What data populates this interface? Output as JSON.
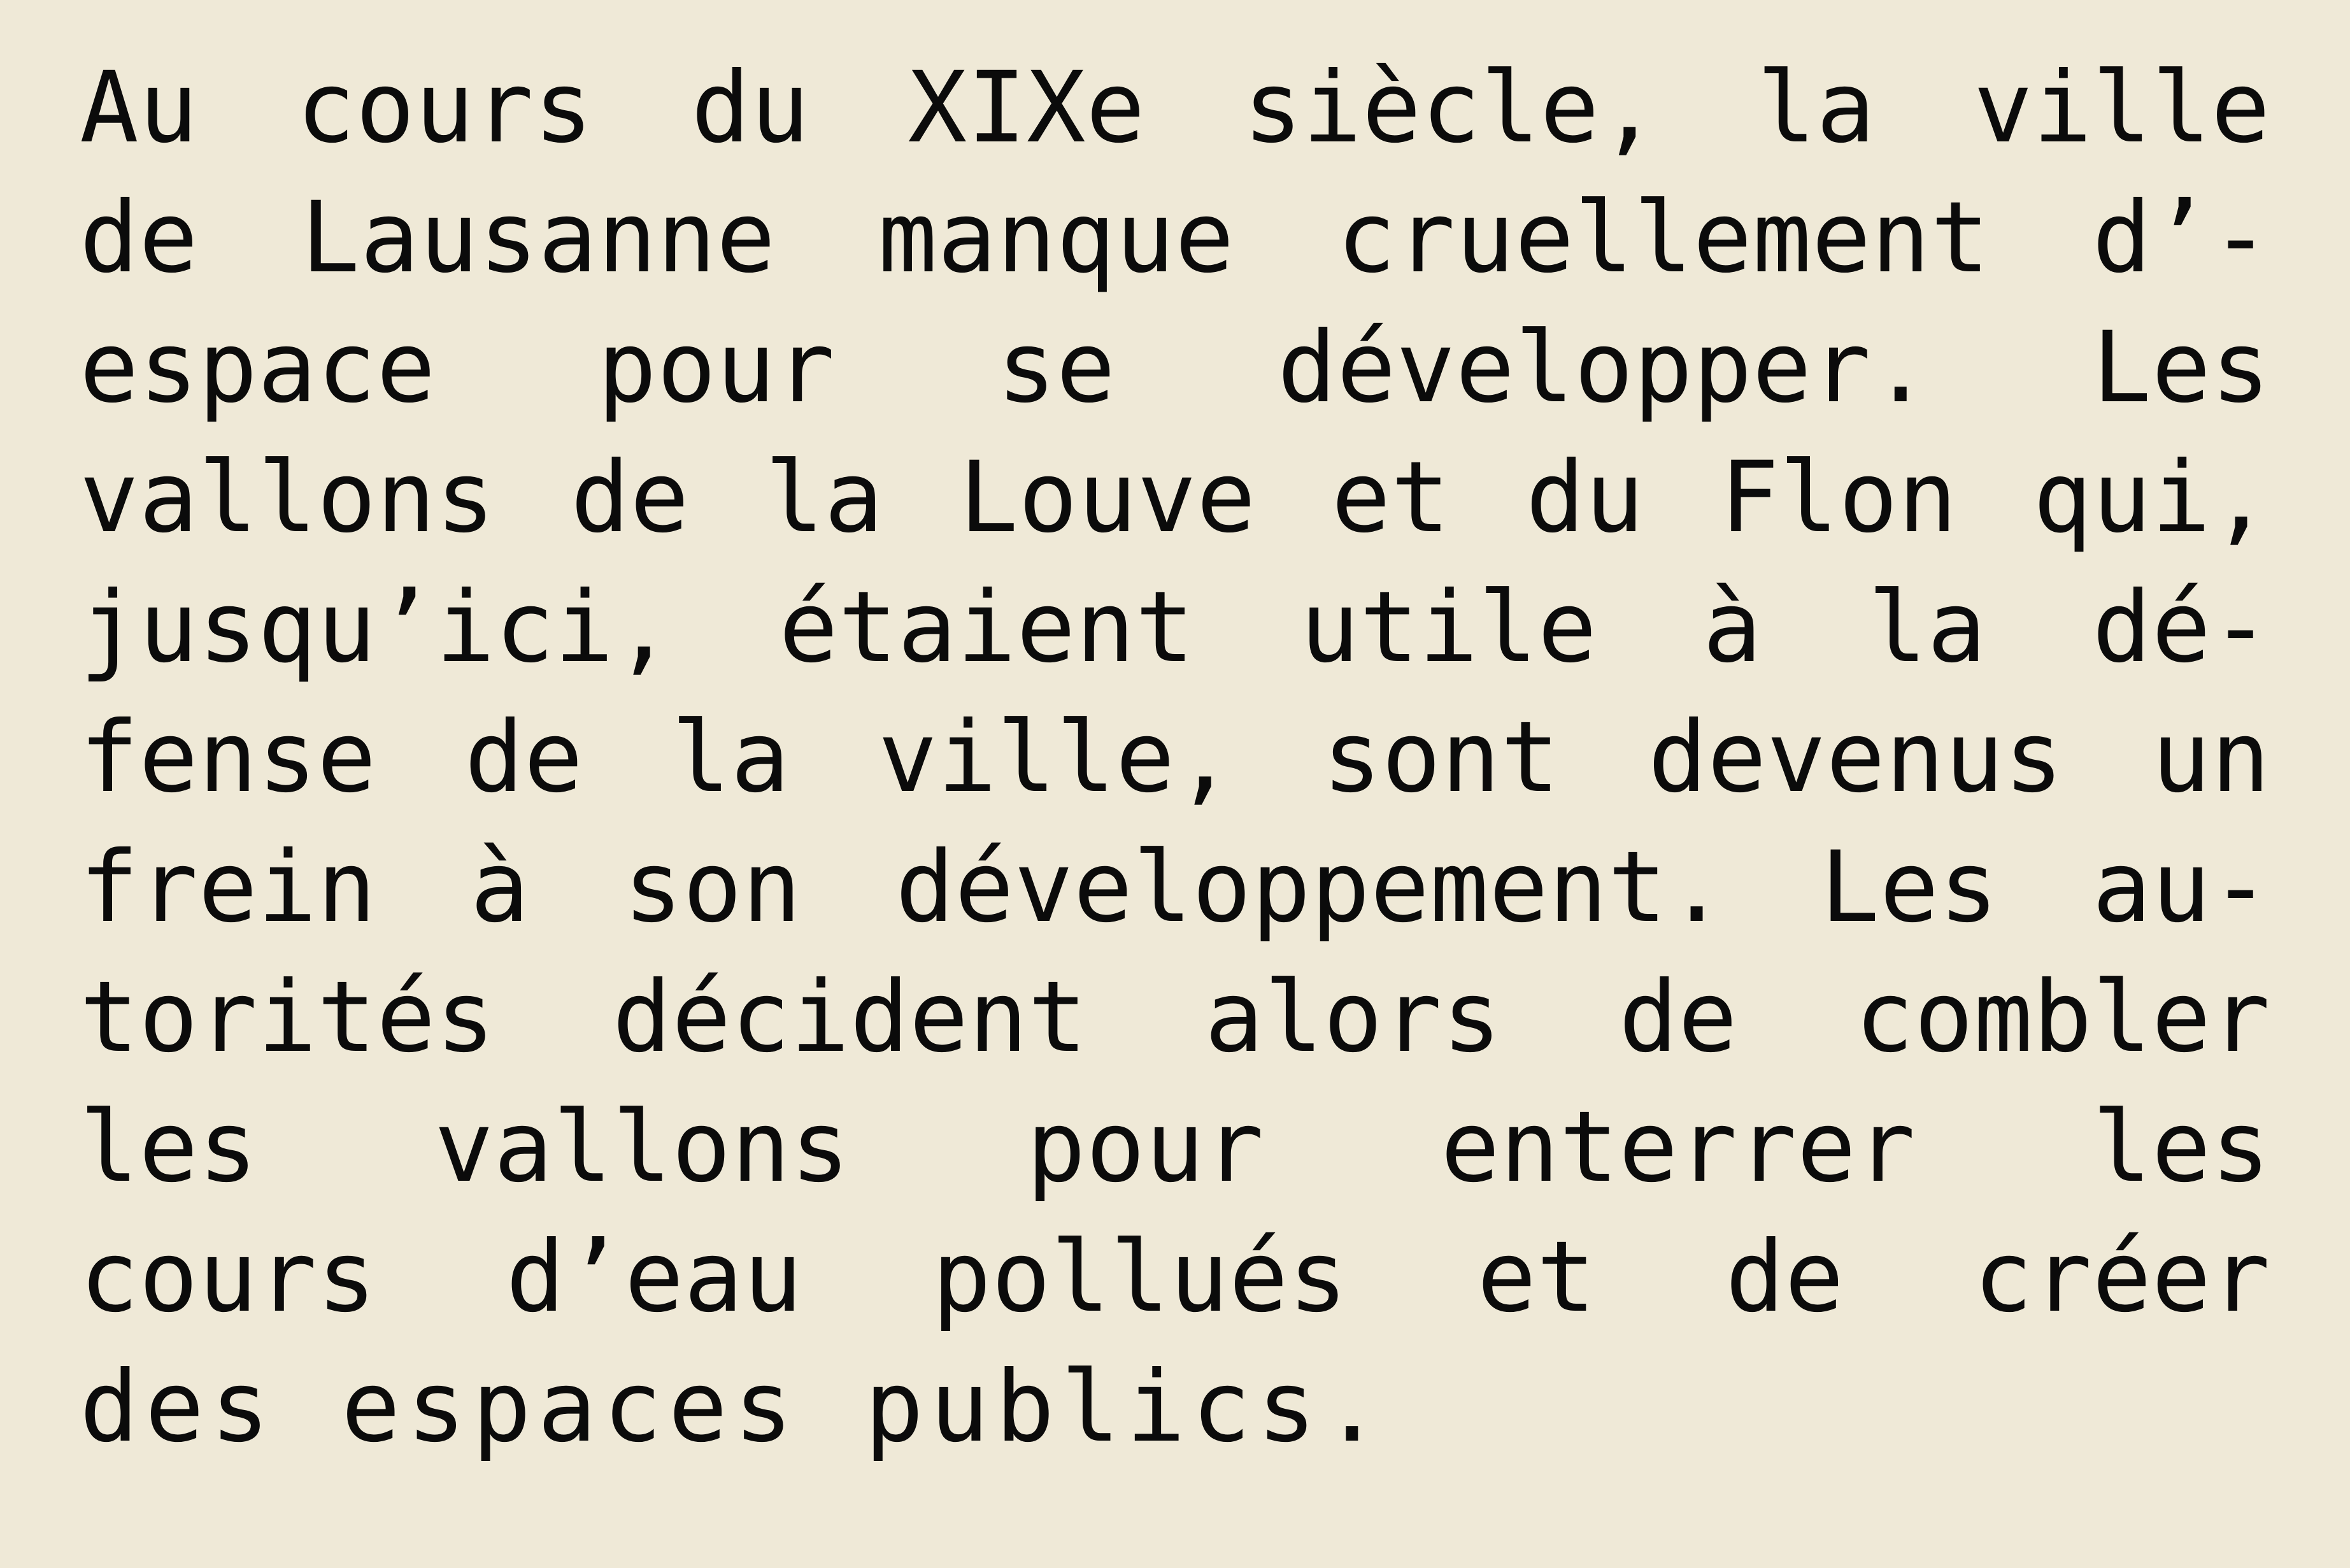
{
  "paragraph": {
    "lines": [
      "Au cours du XIXe siècle, la ville",
      "de Lausanne manque cruellement d’-",
      "espace pour se développer. Les",
      "vallons de la Louve et du Flon qui,",
      "jusqu’ici, étaient utile à la dé-",
      "fense de la ville, sont devenus un",
      "frein à son développement. Les au-",
      "torités décident alors de combler",
      "les vallons pour enterrer les",
      "cours d’eau pollués et de créer",
      "des espaces publics."
    ]
  }
}
